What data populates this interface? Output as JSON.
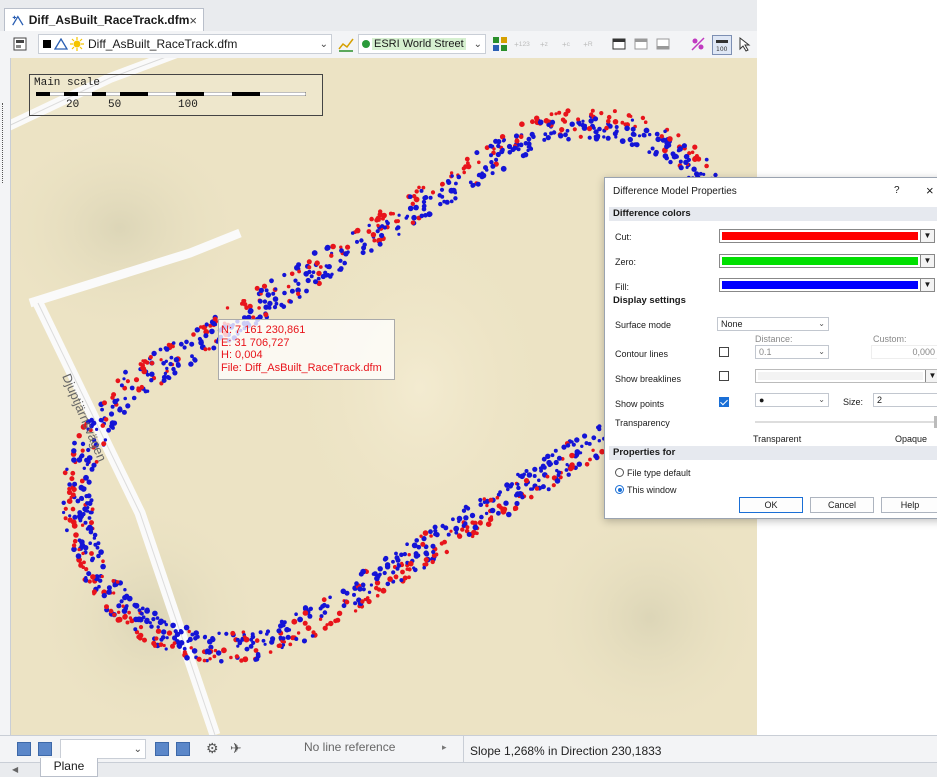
{
  "document_tab": {
    "label": "Diff_AsBuilt_RaceTrack.dfm",
    "close": "×"
  },
  "toolbar": {
    "layer_combo": "Diff_AsBuilt_RaceTrack.dfm",
    "background_map": "ESRI World Street",
    "icons": [
      "properties-icon",
      "square-icon",
      "vector-icon",
      "sun-icon",
      "chart-icon",
      "globe-icon",
      "grid-icon",
      "tag-123-icon",
      "tag-z-icon",
      "tag-c-icon",
      "tag-r-icon",
      "window-icon",
      "window-icon",
      "window-icon",
      "lasso-icon",
      "scale-100-icon",
      "cursor-icon"
    ]
  },
  "map": {
    "street_label": "Djuptjärnsvägen",
    "scale": {
      "title": "Main scale",
      "ticks": [
        "20",
        "50",
        "100"
      ]
    },
    "popup": {
      "n": "N: 7 161 230,861",
      "e": "E: 31 706,727",
      "h": "H: 0,004",
      "file": "File: Diff_AsBuilt_RaceTrack.dfm"
    },
    "colors": {
      "cut": "#e8141b",
      "fill": "#1414d6",
      "land": "#ece3c4"
    }
  },
  "statusbar": {
    "line_reference": "No line reference",
    "slope": "Slope 1,268%  in Direction 230,1833"
  },
  "bottom_tab": {
    "label": "Plane"
  },
  "dialog": {
    "title": "Difference Model Properties",
    "help": "?",
    "close": "×",
    "difference_colors": {
      "header": "Difference colors",
      "cut_label": "Cut:",
      "cut_color": "#ff0000",
      "zero_label": "Zero:",
      "zero_color": "#00e000",
      "fill_label": "Fill:",
      "fill_color": "#0000ff"
    },
    "display_settings": {
      "header": "Display settings",
      "surface_mode_label": "Surface mode",
      "surface_mode_value": "None",
      "distance_label": "Distance:",
      "custom_label": "Custom:",
      "contour_lines_label": "Contour lines",
      "contour_lines_checked": false,
      "distance_value": "0.1",
      "custom_value": "0,000",
      "show_breaklines_label": "Show breaklines",
      "show_breaklines_checked": false,
      "show_points_label": "Show points",
      "show_points_checked": true,
      "point_symbol": "●",
      "size_label": "Size:",
      "size_value": "2",
      "transparency_label": "Transparency",
      "transparent_label": "Transparent",
      "opaque_label": "Opaque",
      "transparency_value": 1.0
    },
    "properties_for": {
      "header": "Properties for",
      "options": [
        "File type default",
        "This window"
      ],
      "selected": "This window"
    },
    "buttons": {
      "ok": "OK",
      "cancel": "Cancel",
      "help": "Help"
    }
  }
}
